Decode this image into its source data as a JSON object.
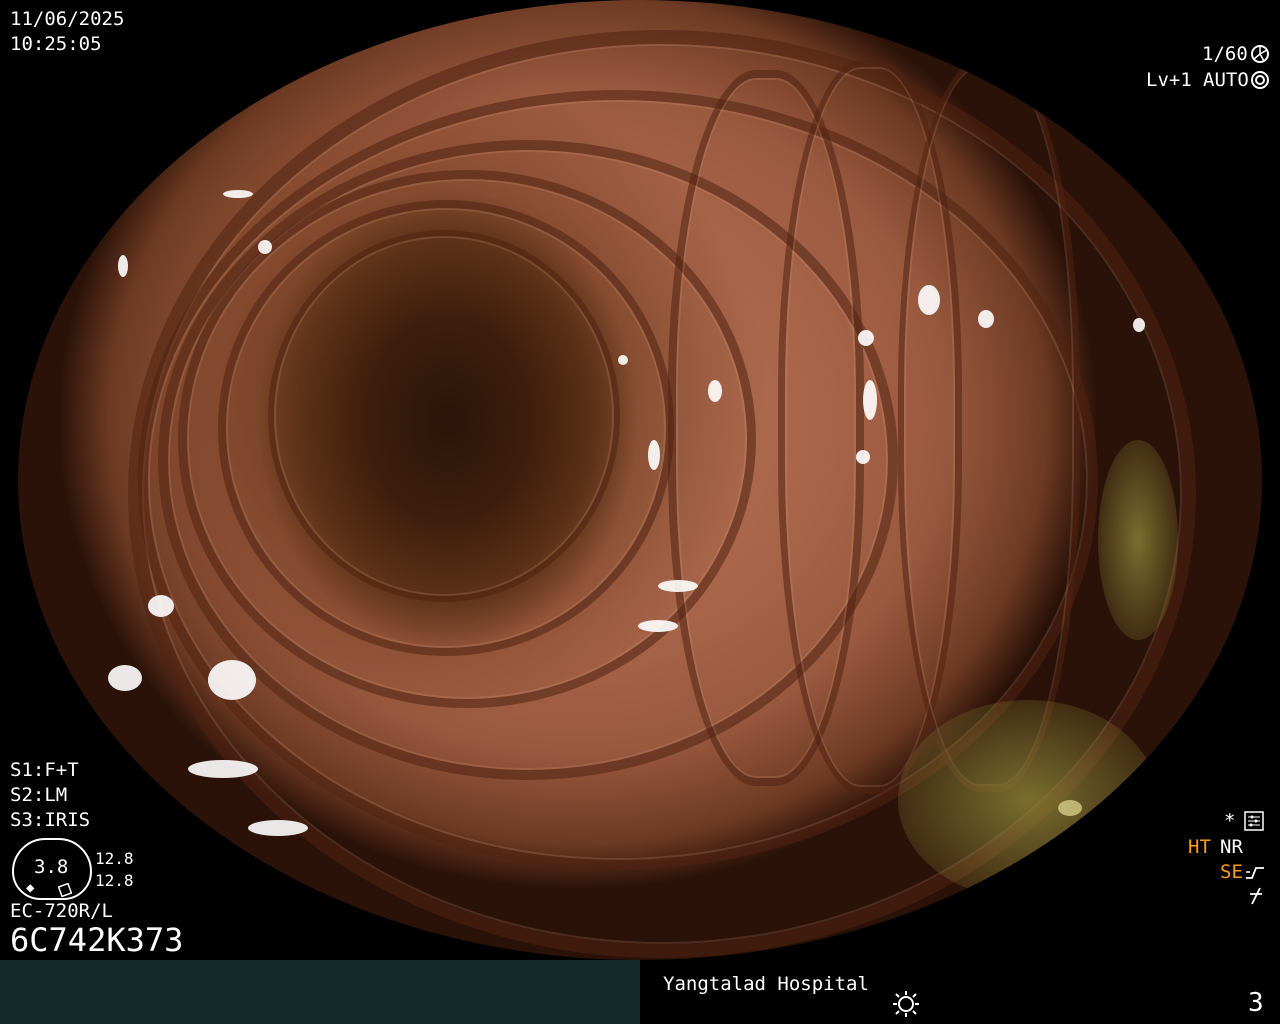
{
  "overlay": {
    "date": "11/06/2025",
    "time": "10:25:05",
    "shutter": "1/60",
    "level": "Lv+1",
    "exposure": "AUTO",
    "s1": "S1:F+T",
    "s2": "S2:LM",
    "s3": "S3:IRIS",
    "gauge_value": "3.8",
    "gauge_top": "12.8",
    "gauge_bottom": "12.8",
    "scope_model": "EC-720R/L",
    "scope_serial": "6C742K373",
    "ht": "HT",
    "nr": "NR",
    "se": "SE",
    "star": "*"
  },
  "footer": {
    "hospital": "Yangtalad Hospital",
    "page_number": "3"
  },
  "icons": {
    "shutter_icon": "shutter-icon",
    "auto_icon": "auto-exposure-icon",
    "settings_icon": "settings-icon",
    "brightness_icon": "brightness-icon",
    "freeze_icon": "lightning-icon",
    "se_icon": "se-curve-icon"
  },
  "colors": {
    "footer_left": "#132a2a",
    "mode_orange": "#ff9c1a"
  }
}
